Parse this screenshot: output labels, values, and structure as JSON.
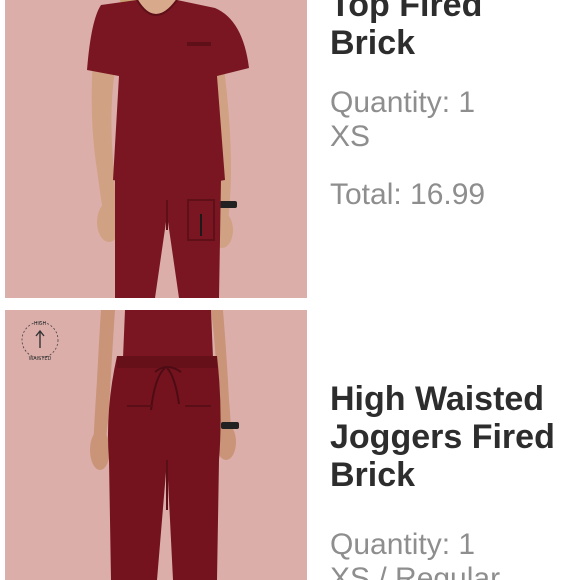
{
  "items": [
    {
      "title_lines": [
        "Top Fired",
        "Brick"
      ],
      "quantity": "Quantity: 1",
      "size": "XS",
      "total": "Total: 16.99"
    },
    {
      "badge_text": "HIGH WAISTED",
      "title_lines": [
        "High Waisted",
        "Joggers Fired",
        "Brick"
      ],
      "quantity": "Quantity: 1",
      "size": "XS / Regular"
    }
  ],
  "colors": {
    "photo_bg": "#dcaeaa",
    "garment": "#7a1622",
    "title_text": "#2d2d2d",
    "meta_text": "#8e8e8e"
  }
}
